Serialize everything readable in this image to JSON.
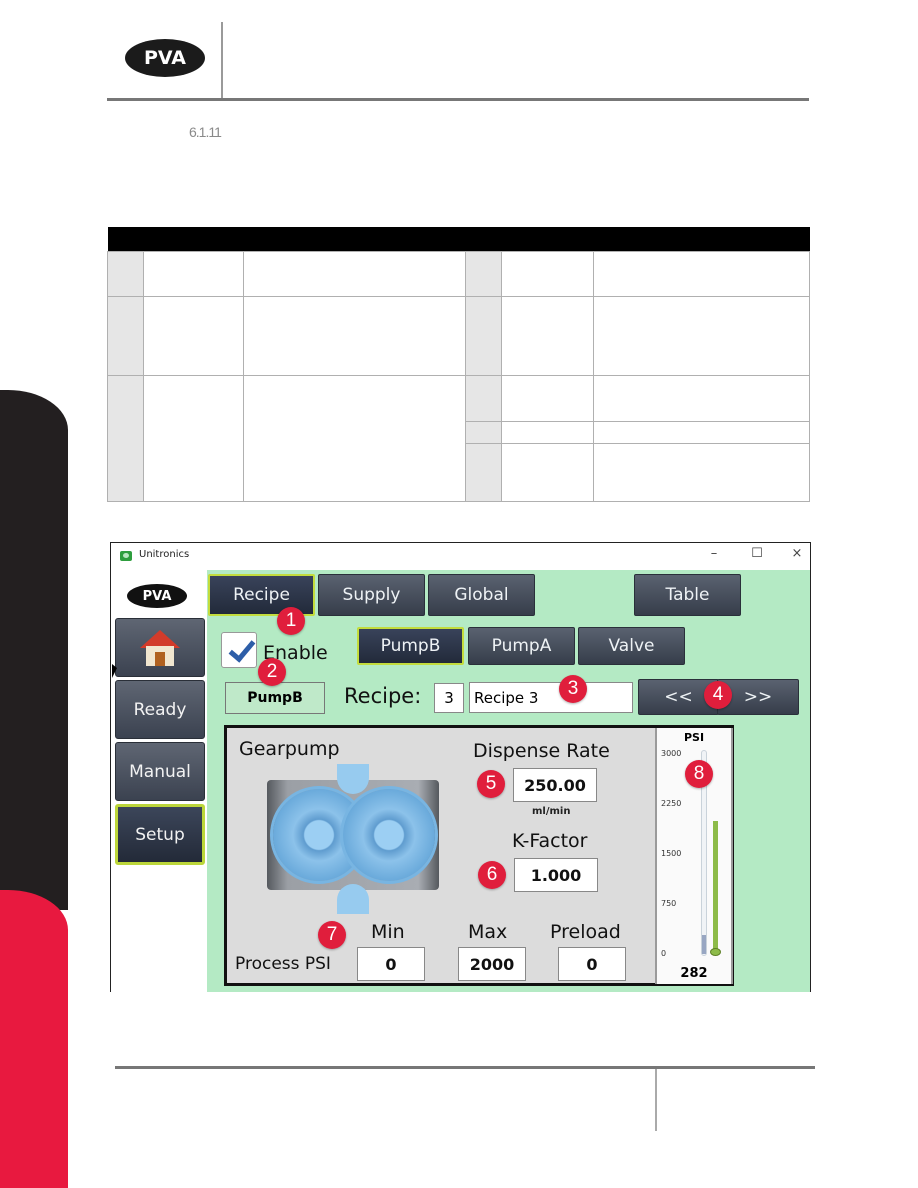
{
  "header": {
    "logo_text": "PVA",
    "section_number": "6.1.11"
  },
  "table": {
    "header": "",
    "rows": [
      {
        "left_num": "",
        "left_name": "",
        "left_desc": "",
        "right_num": "",
        "right_name": "",
        "right_desc": ""
      },
      {
        "left_num": "",
        "left_name": "",
        "left_desc": "",
        "right_num": "",
        "right_name": "",
        "right_desc": ""
      },
      {
        "left_num": "",
        "left_name": "",
        "left_desc": "",
        "right_num": "",
        "right_name": "",
        "right_desc": ""
      },
      {
        "right_num": "",
        "right_name": "",
        "right_desc": ""
      },
      {
        "right_num": "",
        "right_name": "",
        "right_desc": ""
      }
    ]
  },
  "screenshot": {
    "window_title": "Unitronics",
    "window_controls": {
      "minimize": "–",
      "maximize": "☐",
      "close": "×"
    },
    "sidebar": {
      "logo_text": "PVA",
      "items": [
        {
          "label": "",
          "icon": "home-icon"
        },
        {
          "label": "Ready"
        },
        {
          "label": "Manual"
        },
        {
          "label": "Setup",
          "active": true
        }
      ]
    },
    "top_tabs": [
      {
        "label": "Recipe",
        "active": true
      },
      {
        "label": "Supply"
      },
      {
        "label": "Global"
      },
      {
        "label": "Table"
      }
    ],
    "enable": {
      "label": "Enable",
      "checked": true
    },
    "device_tabs": [
      {
        "label": "PumpB",
        "active": true
      },
      {
        "label": "PumpA"
      },
      {
        "label": "Valve"
      }
    ],
    "selected_device": "PumpB",
    "recipe": {
      "label": "Recipe:",
      "number": "3",
      "name": "Recipe 3",
      "prev_label": "<<",
      "next_label": ">>"
    },
    "panel": {
      "title": "Gearpump",
      "dispense_rate": {
        "label": "Dispense Rate",
        "value": "250.00",
        "unit": "ml/min"
      },
      "k_factor": {
        "label": "K-Factor",
        "value": "1.000"
      },
      "process_psi": {
        "label": "Process PSI",
        "min": {
          "label": "Min",
          "value": "0"
        },
        "max": {
          "label": "Max",
          "value": "2000"
        },
        "preload": {
          "label": "Preload",
          "value": "0"
        }
      },
      "gauge": {
        "title": "PSI",
        "ticks": [
          "3000",
          "2250",
          "1500",
          "750",
          "0"
        ],
        "range": [
          0,
          3000
        ],
        "current": 282,
        "current_label": "282",
        "max_setpoint": 2000,
        "min_setpoint": 0
      }
    },
    "callouts": [
      "1",
      "2",
      "3",
      "4",
      "5",
      "6",
      "7",
      "8"
    ],
    "colors": {
      "content_bg": "#b4eac4",
      "badge": "#e01e3c",
      "active_border": "#c3dc3c",
      "button_dark": "#363d4a"
    }
  },
  "side_band": {
    "colors": {
      "dark": "#231f20",
      "red": "#e8193f"
    }
  }
}
